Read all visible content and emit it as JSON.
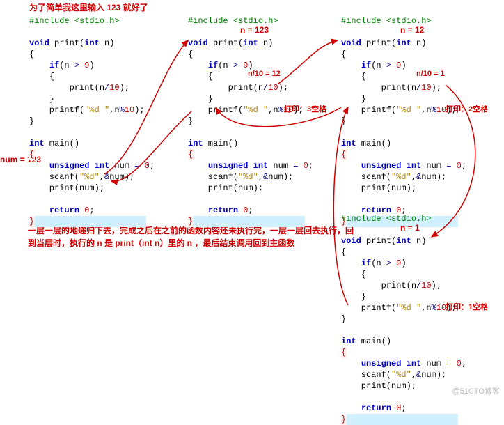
{
  "notes": {
    "top": "为了简单我这里输入 123 就好了",
    "numEq": "num = 123",
    "n123": "n = 123",
    "n12": "n = 12",
    "n1": "n = 1",
    "ndiv12": "n/10 = 12",
    "ndiv1": "n/10 = 1",
    "print3": "打印：3空格",
    "print2": "打印：2空格",
    "print1": "打印：1空格",
    "explain1": "一层一层的地递归下去，完成之后在之前的函数内容还未执行完，一层一层回去执行，回",
    "explain2": "到当层时，执行的 n 是 print（int n）里的 n ，最后结束调用回到主函数"
  },
  "code": {
    "inc": "#include <stdio.h>",
    "voidPrint1": "void",
    "voidPrint2": " print(",
    "voidPrint3": "int",
    "voidPrint4": " n)",
    "obrace": "{",
    "cbrace": "}",
    "if1": "    if(n > 9)",
    "ifOpen": "    {",
    "callPrint": "        print(n/10);",
    "ifClose": "    }",
    "printf1": "    printf(",
    "printfFmt": "\"%d \"",
    "printf2": ",n%10);",
    "intMain1": "int",
    "intMain2": " main()",
    "decl1": "    unsigned int",
    "decl2": " num = 0;",
    "scanf1": "    scanf(",
    "scanfFmt": "\"%d\"",
    "scanf2": ",&num);",
    "callPrintNum": "    print(num);",
    "ret": "    return 0;",
    "nine": "9",
    "ten": "10",
    "zero": "0"
  },
  "watermark": "@51CTO博客"
}
